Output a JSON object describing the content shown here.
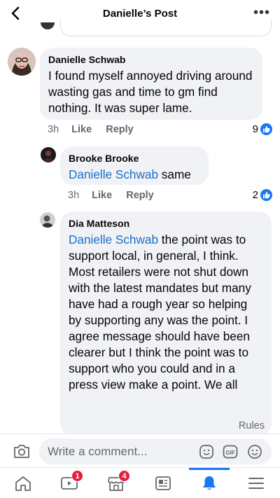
{
  "header": {
    "title": "Danielle’s Post"
  },
  "comments": [
    {
      "author": "Danielle Schwab",
      "mention": "",
      "text": "I found myself annoyed driving around wasting gas and time to gm find nothing. It was super lame.",
      "time": "3h",
      "like_label": "Like",
      "reply_label": "Reply",
      "reaction_count": "9"
    },
    {
      "author": "Brooke Brooke",
      "mention": "Danielle Schwab",
      "text": " same",
      "time": "3h",
      "like_label": "Like",
      "reply_label": "Reply",
      "reaction_count": "2"
    },
    {
      "author": "Dia Matteson",
      "mention": "Danielle Schwab",
      "text": " the point was to support local, in general, I think. Most retailers were not shut down with the latest mandates but many have had a rough year so helping by supporting any was the point. I agree message should have been clearer but I think the point was to support who you could and in a press view make a point. We all"
    }
  ],
  "rules_label": "Rules",
  "composer": {
    "placeholder": "Write a comment..."
  },
  "nav": {
    "video_badge": "1",
    "marketplace_badge": "4"
  },
  "colors": {
    "accent": "#1877f2",
    "mention": "#1c6fc9",
    "bubble": "#f0f2f5",
    "badge": "#e41e3f"
  }
}
